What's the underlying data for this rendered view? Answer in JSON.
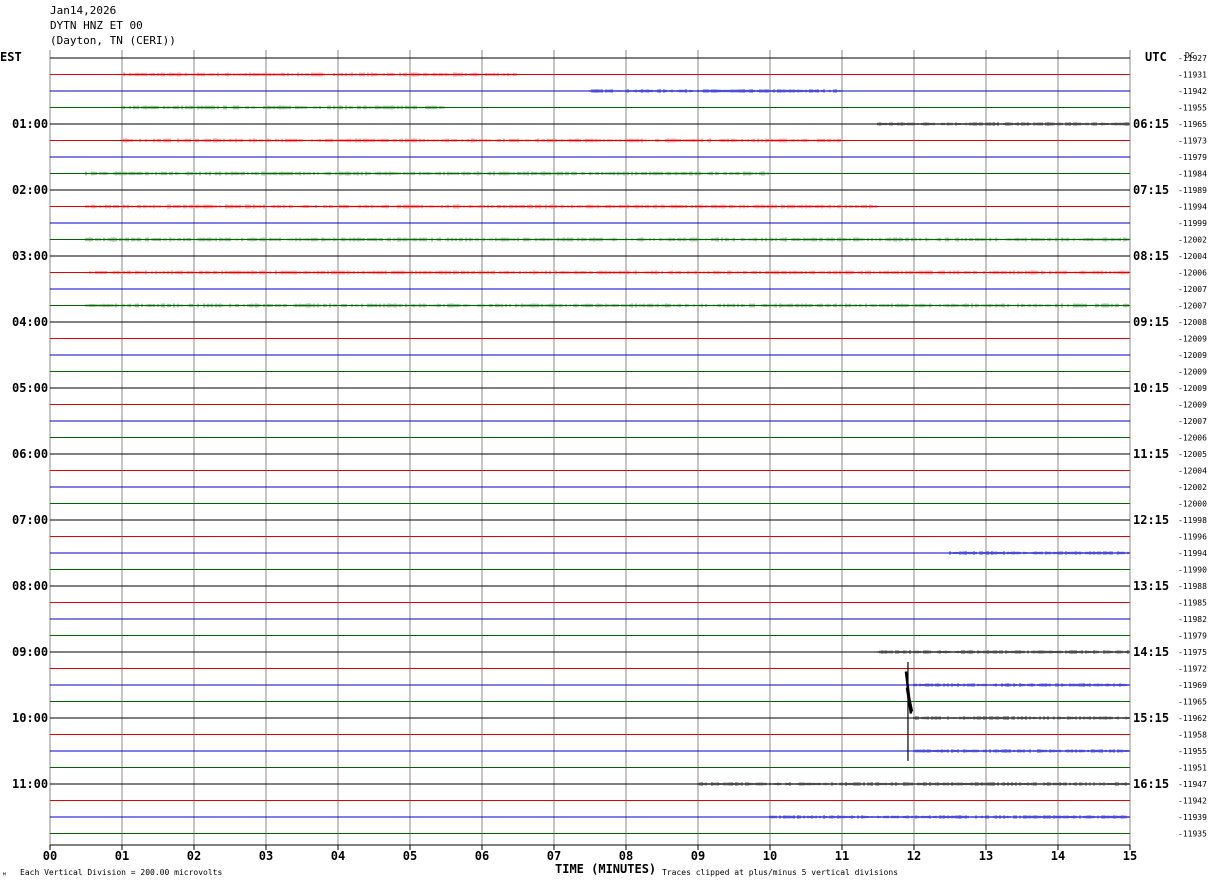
{
  "header": {
    "date": "Jan14,2026",
    "station": "DYTN HNZ ET 00",
    "location": "(Dayton, TN (CERI))"
  },
  "left_tz": "EST",
  "right_tz": "UTC",
  "dc_label": "DC",
  "footer": {
    "division_note": "Each Vertical Division =  200.00 microvolts",
    "xlabel": "TIME (MINUTES)",
    "clip_note": "Traces clipped at plus/minus 5 vertical divisions",
    "corner_mark": "ᴹ"
  },
  "colors": {
    "black": "#000000",
    "red": "#e00000",
    "blue": "#0000cc",
    "green": "#006600",
    "grid": "#888888"
  },
  "chart_data": {
    "type": "line",
    "title": "DYTN HNZ ET 00",
    "xlabel": "TIME (MINUTES)",
    "x_ticks": [
      "00",
      "01",
      "02",
      "03",
      "04",
      "05",
      "06",
      "07",
      "08",
      "09",
      "10",
      "11",
      "12",
      "13",
      "14",
      "15"
    ],
    "xlim": [
      0,
      15
    ],
    "trace_color_cycle": [
      "black",
      "red",
      "blue",
      "green"
    ],
    "left_hour_labels": [
      "01:00",
      "02:00",
      "03:00",
      "04:00",
      "05:00",
      "06:00",
      "07:00",
      "08:00",
      "09:00",
      "10:00",
      "11:00"
    ],
    "right_hour_labels": [
      "06:15",
      "07:15",
      "08:15",
      "09:15",
      "10:15",
      "11:15",
      "12:15",
      "13:15",
      "14:15",
      "15:15",
      "16:15"
    ],
    "hour_label_first_trace": 4,
    "hour_label_every": 4,
    "dc_offsets": [
      "-11927",
      "-11931",
      "-11942",
      "-11955",
      "-11965",
      "-11973",
      "-11979",
      "-11984",
      "-11989",
      "-11994",
      "-11999",
      "-12002",
      "-12004",
      "-12006",
      "-12007",
      "-12007",
      "-12008",
      "-12009",
      "-12009",
      "-12009",
      "-12009",
      "-12009",
      "-12007",
      "-12006",
      "-12005",
      "-12004",
      "-12002",
      "-12000",
      "-11998",
      "-11996",
      "-11994",
      "-11990",
      "-11988",
      "-11985",
      "-11982",
      "-11979",
      "-11975",
      "-11972",
      "-11969",
      "-11965",
      "-11962",
      "-11958",
      "-11955",
      "-11951",
      "-11947",
      "-11942",
      "-11939",
      "-11935"
    ],
    "event": {
      "trace_index": 39,
      "time_min": 11.93,
      "amplitude_divisions_up": 2.4,
      "amplitude_divisions_down": 3.6
    },
    "noise_bands": [
      {
        "trace": 1,
        "from": 1.0,
        "to": 6.5
      },
      {
        "trace": 2,
        "from": 7.5,
        "to": 11.0
      },
      {
        "trace": 3,
        "from": 1.0,
        "to": 5.5
      },
      {
        "trace": 4,
        "from": 11.5,
        "to": 15.0
      },
      {
        "trace": 5,
        "from": 1.0,
        "to": 11.0
      },
      {
        "trace": 7,
        "from": 0.5,
        "to": 10.0
      },
      {
        "trace": 9,
        "from": 0.5,
        "to": 11.5
      },
      {
        "trace": 11,
        "from": 0.5,
        "to": 15.0
      },
      {
        "trace": 13,
        "from": 0.5,
        "to": 15.0
      },
      {
        "trace": 15,
        "from": 0.5,
        "to": 15.0
      },
      {
        "trace": 30,
        "from": 12.5,
        "to": 15.0
      },
      {
        "trace": 36,
        "from": 11.5,
        "to": 15.0
      },
      {
        "trace": 38,
        "from": 12.0,
        "to": 15.0
      },
      {
        "trace": 40,
        "from": 12.0,
        "to": 15.0
      },
      {
        "trace": 42,
        "from": 12.0,
        "to": 15.0
      },
      {
        "trace": 44,
        "from": 9.0,
        "to": 15.0
      },
      {
        "trace": 46,
        "from": 10.0,
        "to": 15.0
      }
    ]
  }
}
